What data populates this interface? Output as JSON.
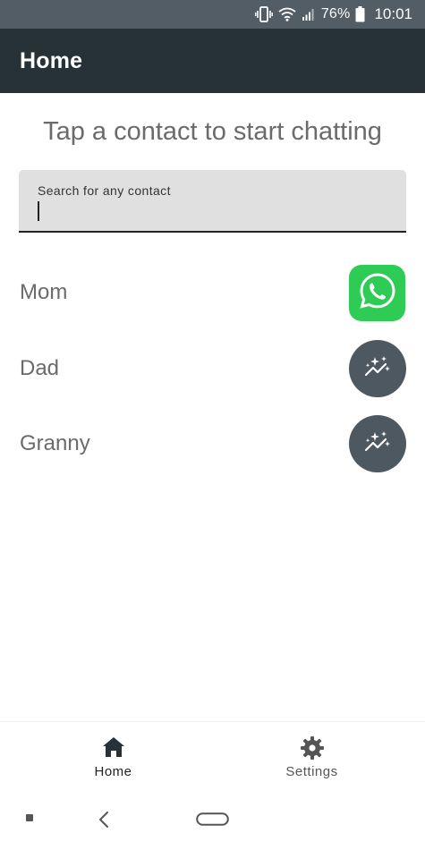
{
  "status_bar": {
    "battery": "76%",
    "time": "10:01",
    "icons": [
      "vibrate-icon",
      "wifi-icon",
      "signal-icon",
      "battery-icon"
    ]
  },
  "app_bar": {
    "title": "Home"
  },
  "main": {
    "heading": "Tap a contact to start chatting",
    "search": {
      "label": "Search for any contact",
      "value": ""
    },
    "contacts": [
      {
        "name": "Mom",
        "action_icon": "whatsapp-icon"
      },
      {
        "name": "Dad",
        "action_icon": "sparkle-chart-icon"
      },
      {
        "name": "Granny",
        "action_icon": "sparkle-chart-icon"
      }
    ]
  },
  "bottom_nav": {
    "items": [
      {
        "label": "Home",
        "icon": "home-icon",
        "selected": true
      },
      {
        "label": "Settings",
        "icon": "gear-icon",
        "selected": false
      }
    ]
  },
  "colors": {
    "status_bar": "#525d66",
    "app_bar": "#263238",
    "whatsapp_green": "#2fcc55",
    "ai_button": "#4d5860",
    "search_bg": "#e0e0e0",
    "text_gray": "#6b6b6b"
  }
}
